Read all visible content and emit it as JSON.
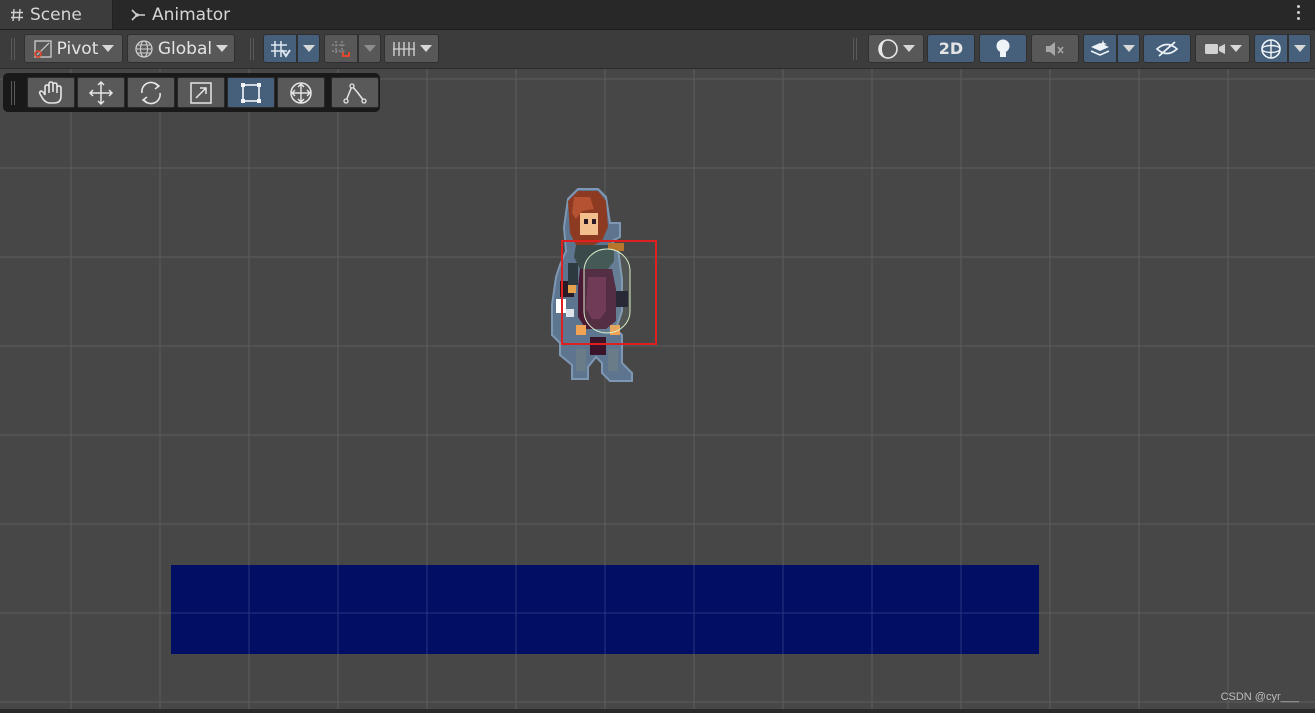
{
  "tabs": [
    {
      "label": "Scene",
      "icon": "hash-icon",
      "active": true
    },
    {
      "label": "Animator",
      "icon": "animator-icon",
      "active": false
    }
  ],
  "toolbar": {
    "pivot_label": "Pivot",
    "global_label": "Global",
    "mode_2d_label": "2D",
    "icons": [
      "pivot-icon",
      "globe-icon",
      "grid-snap-icon",
      "increment-snap-icon",
      "grid-visibility-icon",
      "shading-mode-icon",
      "lighting-icon",
      "audio-mute-icon",
      "effects-icon",
      "scene-visibility-icon",
      "camera-icon",
      "gizmos-icon"
    ]
  },
  "tools": [
    {
      "name": "view-tool",
      "icon": "hand-icon",
      "active": false
    },
    {
      "name": "move-tool",
      "icon": "move-arrows-icon",
      "active": false
    },
    {
      "name": "rotate-tool",
      "icon": "rotate-icon",
      "active": false
    },
    {
      "name": "scale-tool",
      "icon": "scale-icon",
      "active": false
    },
    {
      "name": "rect-tool",
      "icon": "rect-transform-icon",
      "active": true
    },
    {
      "name": "transform-tool",
      "icon": "transform-icon",
      "active": false
    },
    {
      "name": "custom-editor-tool",
      "icon": "vertex-path-icon",
      "active": false
    }
  ],
  "scene": {
    "background_color": "#474747",
    "ground_color": "#000e63",
    "collider_color": "#e02020"
  },
  "watermark": "CSDN @cyr___"
}
